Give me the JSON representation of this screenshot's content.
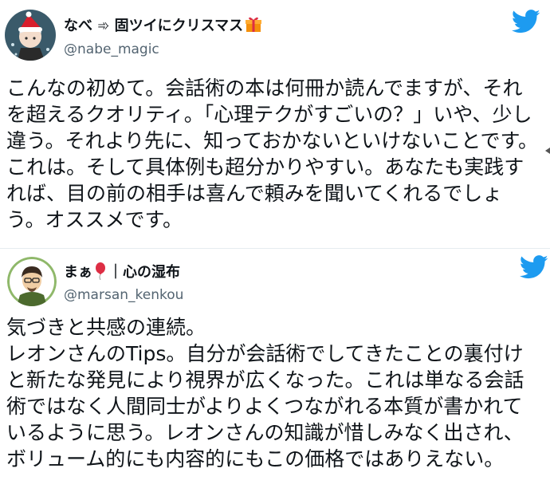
{
  "colors": {
    "twitter_blue": "#1d9bf0",
    "text": "#0f1419",
    "handle_gray": "#536471"
  },
  "tweets": [
    {
      "display_name": "なべ ➾ 固ツイにクリスマス",
      "name_emoji": "gift-icon",
      "handle": "@nabe_magic",
      "avatar": "anime-character-santa-hat-avatar",
      "logo": "twitter-bird-icon",
      "body": "こんなの初めて。会話術の本は何冊か読んでますが、それを超えるクオリティ。「心理テクがすごいの？」いや、少し違う。それより先に、知っておかないといけないことです。これは。そして具体例も超分かりやすい。あなたも実践すれば、目の前の相手は喜んで頼みを聞いてくれるでしょう。オススメです。"
    },
    {
      "display_name_part1": "まぁ",
      "name_emoji": "balloon-icon",
      "display_name_part2": "｜心の湿布",
      "handle": "@marsan_kenkou",
      "avatar": "illustrated-man-glasses-avatar",
      "logo": "twitter-bird-icon",
      "body": "気づきと共感の連続。\nレオンさんのTips。自分が会話術でしてきたことの裏付けと新たな発見により視界が広くなった。これは単なる会話術ではなく人間同士がよりよくつながれる本質が書かれているように思う。レオンさんの知識が惜しみなく出され、ボリューム的にも内容的にもこの価格ではありえない。"
    }
  ]
}
